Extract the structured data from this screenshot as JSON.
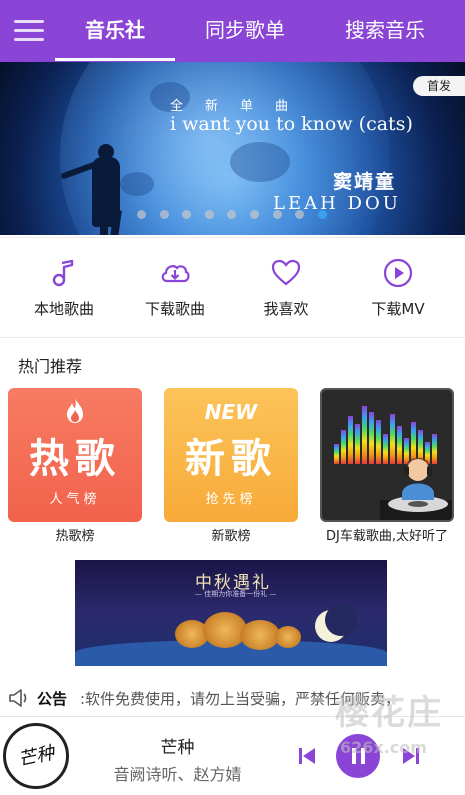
{
  "header": {
    "tabs": [
      {
        "label": "音乐社",
        "active": true
      },
      {
        "label": "同步歌单",
        "active": false
      },
      {
        "label": "搜索音乐",
        "active": false
      }
    ]
  },
  "banner": {
    "badge": "首发",
    "subtitle": "全新单曲",
    "song_title": "i want you to know (cats)",
    "artist_cn": "窦靖童",
    "artist_en": "LEAH DOU",
    "slide_count": 9,
    "active_slide": 8
  },
  "quick_actions": [
    {
      "label": "本地歌曲",
      "icon": "music-note-icon"
    },
    {
      "label": "下载歌曲",
      "icon": "cloud-download-icon"
    },
    {
      "label": "我喜欢",
      "icon": "heart-icon"
    },
    {
      "label": "下载MV",
      "icon": "play-circle-icon"
    }
  ],
  "section": {
    "title": "热门推荐"
  },
  "cards": [
    {
      "big": "热歌",
      "sub": "人气榜",
      "caption": "热歌榜"
    },
    {
      "tag": "NEW",
      "big": "新歌",
      "sub": "抢先榜",
      "caption": "新歌榜"
    },
    {
      "caption": "DJ车载歌曲,太好听了"
    }
  ],
  "promo": {
    "title": "中秋遇礼",
    "subtitle": "— 佳期为你准备一份礼 —"
  },
  "notice": {
    "label": "公告",
    "text": ":软件免费使用，请勿上当受骗，严禁任何贩卖，"
  },
  "player": {
    "cover_text": "芒种",
    "title": "芒种",
    "artist": "音阙诗听、赵方婧"
  },
  "watermark": {
    "text": "樱花庄",
    "sub": "626x.com"
  },
  "colors": {
    "primary": "#8a44d6",
    "hot_card": "#f2624c",
    "new_card": "#f7aa38",
    "active_dot": "#3aa0f0"
  }
}
